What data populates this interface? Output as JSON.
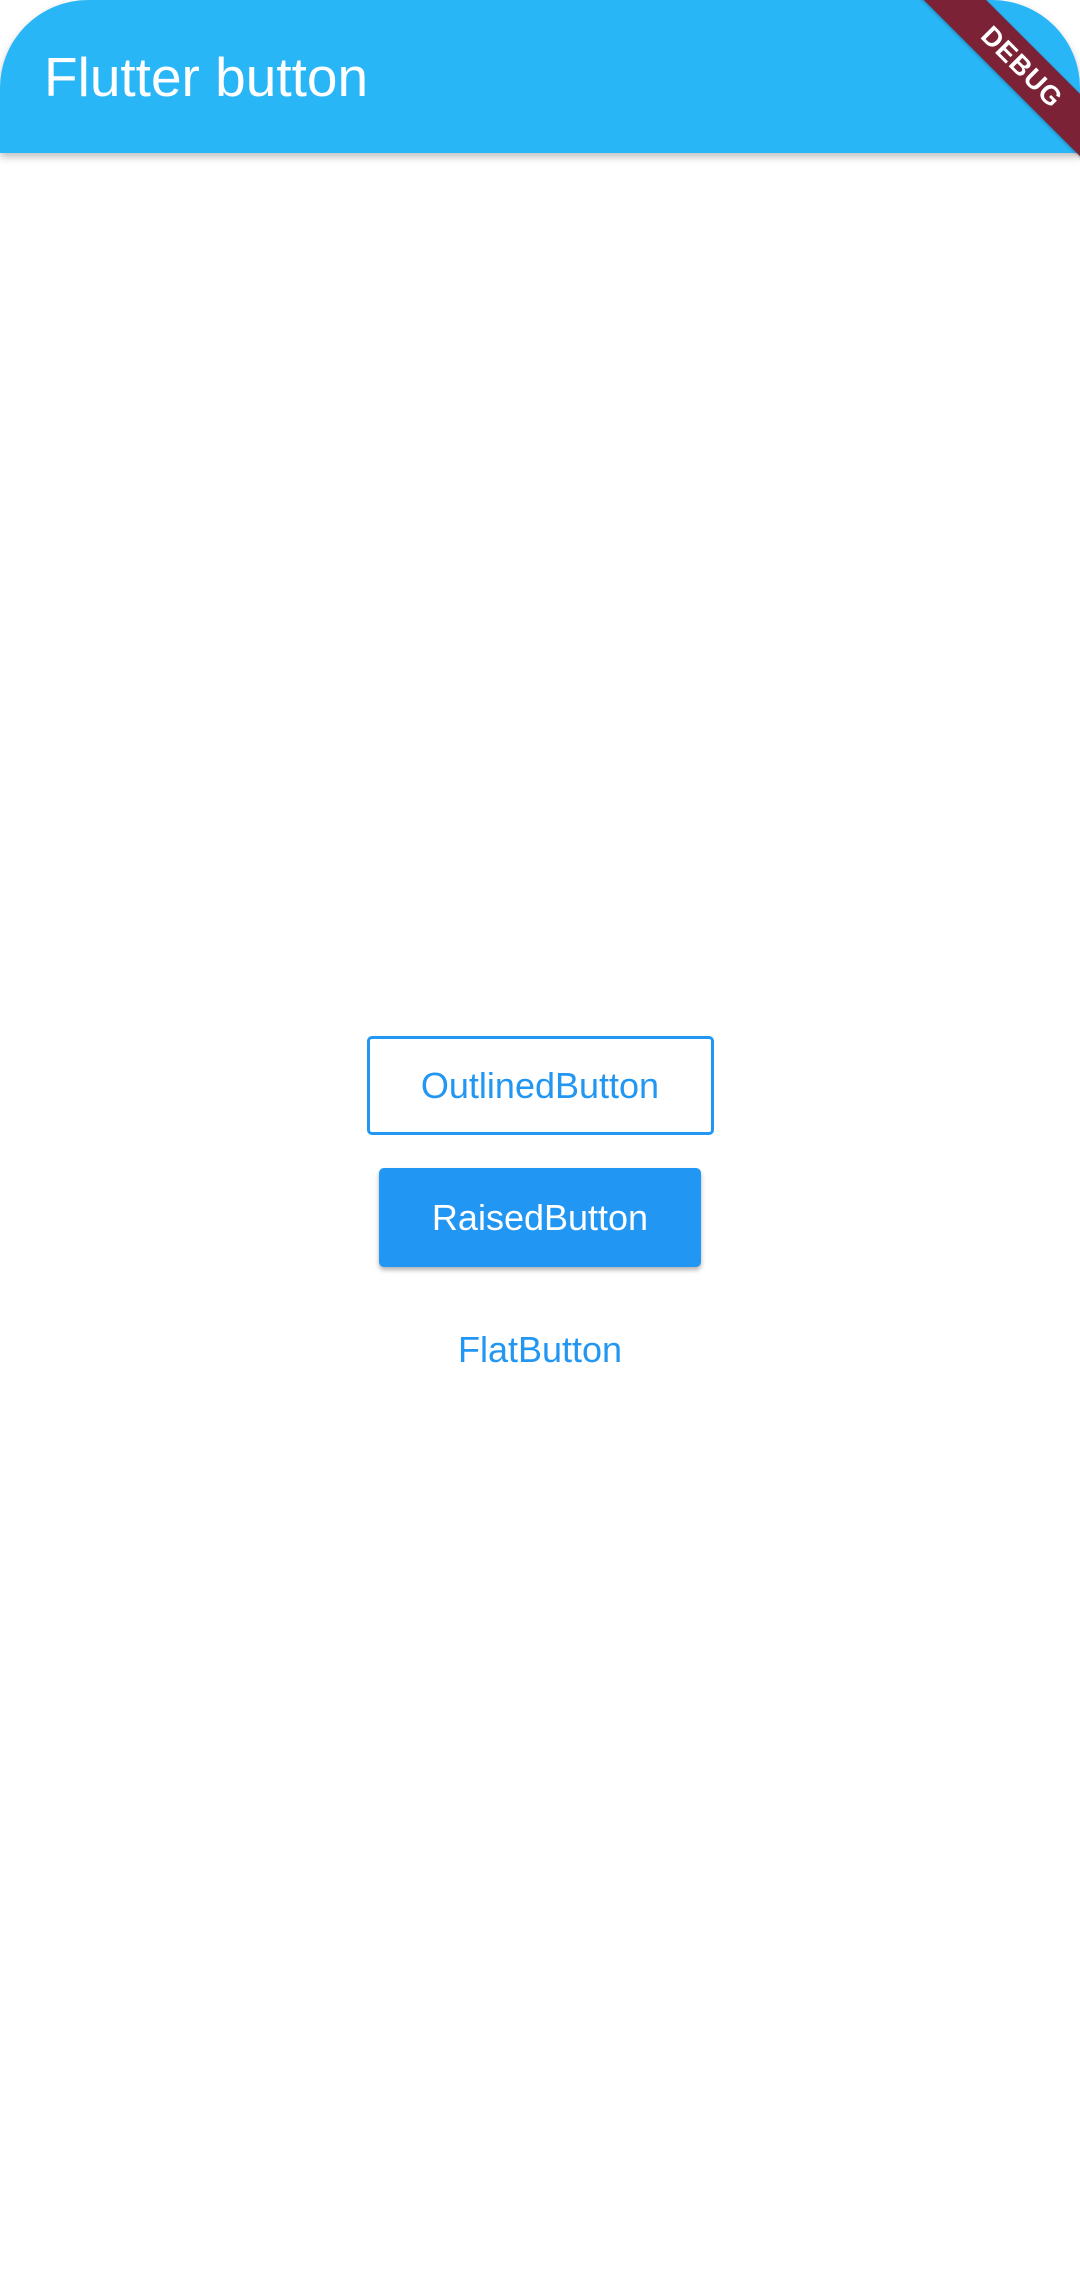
{
  "app_bar": {
    "title": "Flutter button",
    "background_color": "#29b6f6"
  },
  "debug_banner": {
    "label": "DEBUG",
    "color": "#7b2237"
  },
  "buttons": {
    "outlined_label": "OutlinedButton",
    "raised_label": "RaisedButton",
    "flat_label": "FlatButton",
    "accent_color": "#2196f3"
  }
}
